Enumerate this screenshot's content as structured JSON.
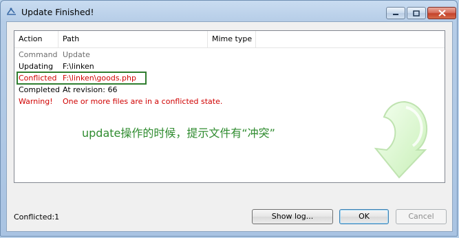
{
  "window": {
    "title": "Update Finished!"
  },
  "list": {
    "columns": [
      "Action",
      "Path",
      "Mime type"
    ],
    "rows": [
      {
        "action": "Command",
        "path": "Update",
        "style": "gray"
      },
      {
        "action": "Updating",
        "path": "F:\\linken",
        "style": "normal"
      },
      {
        "action": "Conflicted",
        "path": "F:\\linken\\goods.php",
        "style": "red"
      },
      {
        "action": "Completed",
        "path": "At revision: 66",
        "style": "normal"
      },
      {
        "action": "Warning!",
        "path": "One or more files are in a conflicted state.",
        "style": "red"
      }
    ]
  },
  "annotation": {
    "note": "update操作的时候，提示文件有“冲突”"
  },
  "status": {
    "text": "Conflicted:1"
  },
  "buttons": {
    "show_log": "Show log...",
    "ok": "OK",
    "cancel": "Cancel"
  },
  "colors": {
    "conflict_red": "#d00000",
    "annotation_green": "#2e8b2e",
    "highlight_box": "#2f7d2f"
  }
}
